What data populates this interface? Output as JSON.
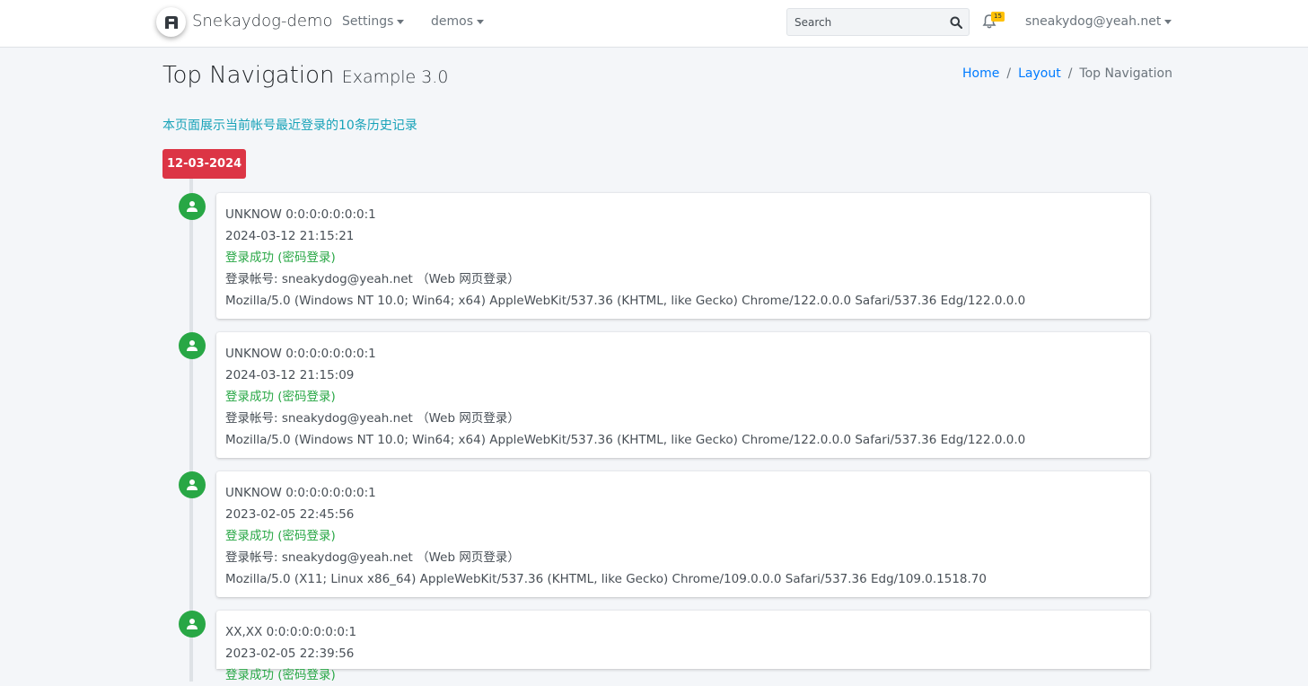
{
  "navbar": {
    "brand": "Snekaydog-demo",
    "settings_label": "Settings",
    "demos_label": "demos",
    "search_placeholder": "Search",
    "notification_count": "15",
    "user_email": "sneakydog@yeah.net"
  },
  "header": {
    "title": "Top Navigation",
    "subtitle": "Example 3.0"
  },
  "breadcrumb": {
    "home": "Home",
    "layout": "Layout",
    "current": "Top Navigation"
  },
  "intro": "本页面展示当前帐号最近登录的10条历史记录",
  "timeline": {
    "date": "12-03-2024",
    "entries": [
      {
        "location": "UNKNOW 0:0:0:0:0:0:0:1",
        "time": "2024-03-12 21:15:21",
        "status": "登录成功 (密码登录)",
        "account": "登录帐号: sneakydog@yeah.net （Web 网页登录）",
        "agent": "Mozilla/5.0 (Windows NT 10.0; Win64; x64) AppleWebKit/537.36 (KHTML, like Gecko) Chrome/122.0.0.0 Safari/537.36 Edg/122.0.0.0"
      },
      {
        "location": "UNKNOW 0:0:0:0:0:0:0:1",
        "time": "2024-03-12 21:15:09",
        "status": "登录成功 (密码登录)",
        "account": "登录帐号: sneakydog@yeah.net （Web 网页登录）",
        "agent": "Mozilla/5.0 (Windows NT 10.0; Win64; x64) AppleWebKit/537.36 (KHTML, like Gecko) Chrome/122.0.0.0 Safari/537.36 Edg/122.0.0.0"
      },
      {
        "location": "UNKNOW 0:0:0:0:0:0:0:1",
        "time": "2023-02-05 22:45:56",
        "status": "登录成功 (密码登录)",
        "account": "登录帐号: sneakydog@yeah.net （Web 网页登录）",
        "agent": "Mozilla/5.0 (X11; Linux x86_64) AppleWebKit/537.36 (KHTML, like Gecko) Chrome/109.0.0.0 Safari/537.36 Edg/109.0.1518.70"
      },
      {
        "location": "XX,XX 0:0:0:0:0:0:0:1",
        "time": "2023-02-05 22:39:56",
        "status": "登录成功 (密码登录)"
      }
    ]
  },
  "colors": {
    "accent": "#007bff",
    "success": "#28a745",
    "danger": "#dc3545",
    "info": "#17a2b8",
    "badge": "#ffc107"
  }
}
